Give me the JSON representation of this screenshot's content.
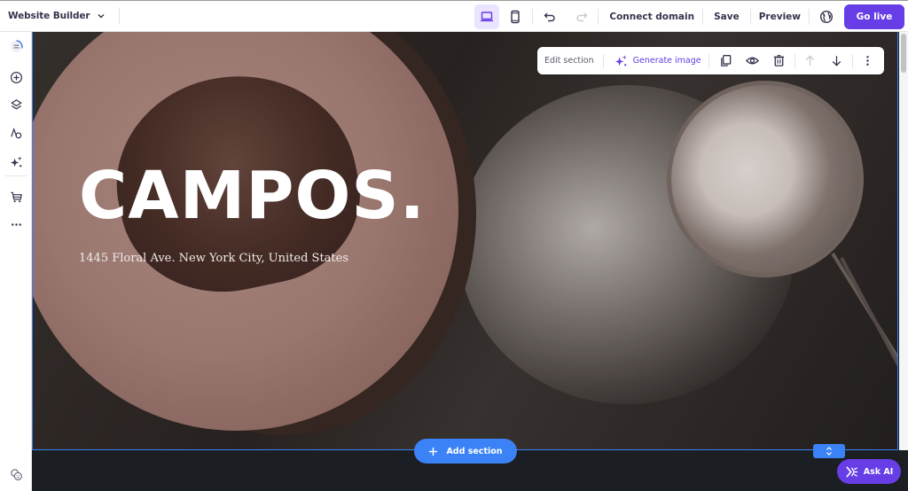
{
  "topbar": {
    "title": "Website Builder",
    "title_chevron_icon": "chevron-down-icon",
    "devices": [
      {
        "name": "desktop",
        "icon": "laptop-icon",
        "active": true
      },
      {
        "name": "mobile",
        "icon": "phone-icon",
        "active": false
      }
    ],
    "undo_icon": "undo-icon",
    "redo_icon": "redo-icon",
    "connect_domain": "Connect domain",
    "save": "Save",
    "preview": "Preview",
    "globe_icon": "globe-icon",
    "go_live": "Go live"
  },
  "sidebar": {
    "items": [
      {
        "name": "progress-checklist",
        "icon": "checklist-progress-icon"
      },
      {
        "name": "add-element",
        "icon": "plus-circle-icon"
      },
      {
        "name": "layers",
        "icon": "layers-icon"
      },
      {
        "name": "styles",
        "icon": "styles-icon"
      },
      {
        "name": "ai-tools",
        "icon": "sparkles-icon"
      },
      {
        "name": "store",
        "icon": "cart-icon"
      },
      {
        "name": "more",
        "icon": "more-horizontal-icon"
      }
    ],
    "bottom_item": {
      "name": "help",
      "icon": "help-faces-icon"
    }
  },
  "hero": {
    "title": "CAMPOS.",
    "address": "1445 Floral Ave. New York City, United States"
  },
  "section_toolbar": {
    "edit_section": "Edit section",
    "generate_image": "Generate image",
    "actions": [
      "duplicate",
      "hide",
      "delete",
      "move-up",
      "move-down",
      "more"
    ]
  },
  "canvas": {
    "add_section": "Add section",
    "ask_ai": "Ask AI"
  },
  "colors": {
    "brand_purple": "#673de6",
    "selection_blue": "#3b82f6",
    "active_device_bg": "#ebe4ff",
    "text_dark": "#36344d"
  }
}
